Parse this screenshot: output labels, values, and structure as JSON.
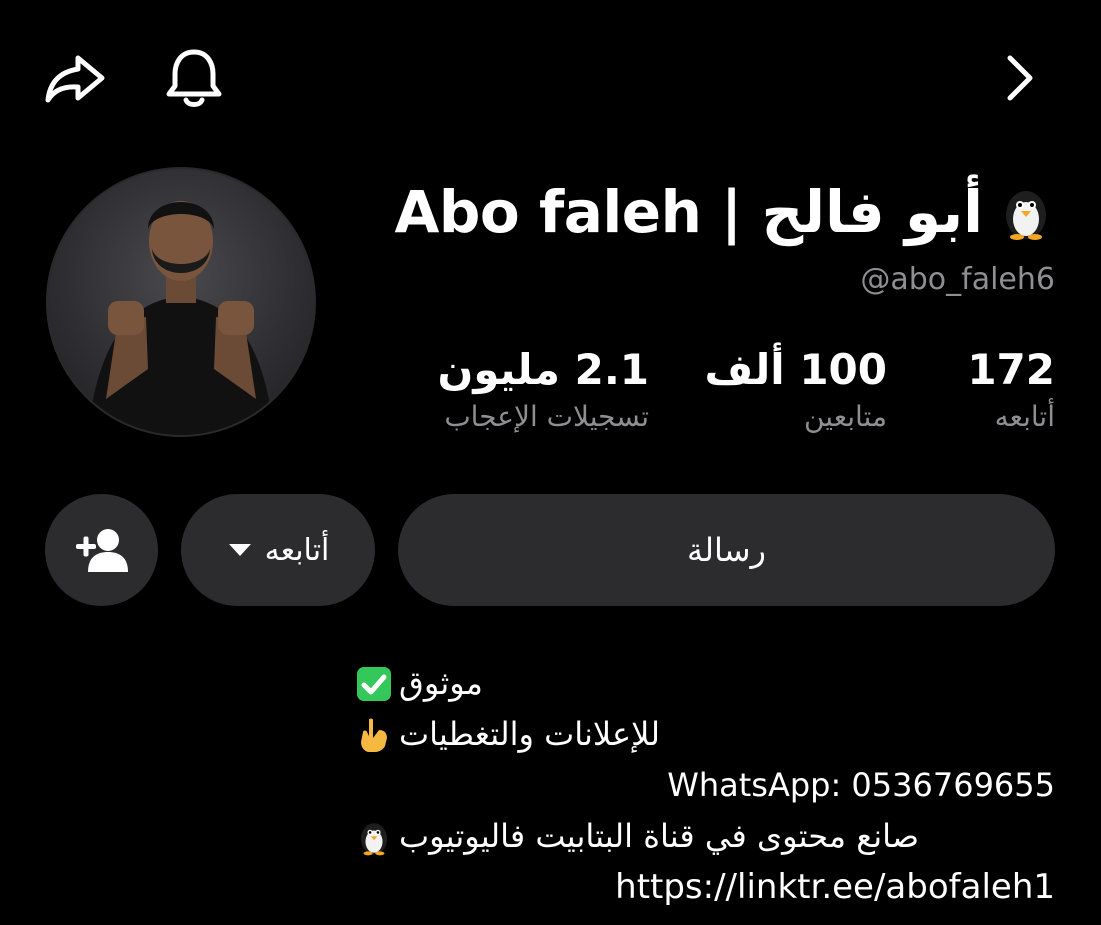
{
  "header": {
    "share_icon": "share-arrow-icon",
    "bell_icon": "bell-icon",
    "forward_icon": "chevron-right-icon"
  },
  "profile": {
    "display_name": "Abo faleh | أبو فالح",
    "username": "@abo_faleh6",
    "avatar_icon": "profile-photo"
  },
  "stats": {
    "following": {
      "value": "172",
      "label": "أتابعه"
    },
    "followers": {
      "value": "100 ألف",
      "label": "متابعين"
    },
    "likes": {
      "value": "2.1 مليون",
      "label": "تسجيلات الإعجاب"
    }
  },
  "actions": {
    "message_label": "رسالة",
    "follow_label": "أتابعه",
    "add_friend_icon": "add-person-icon"
  },
  "bio": {
    "line1": "موثوق",
    "line2": "للإعلانات والتغطيات",
    "line3": "WhatsApp: 0536769655",
    "line4": "صانع محتوى في قناة البتابيت فاليوتيوب",
    "link": "https://linktr.ee/abofaleh1"
  },
  "colors": {
    "background": "#000000",
    "pill": "#2c2c2e",
    "secondary_text": "#8e8e93",
    "verified_green": "#34c759"
  }
}
